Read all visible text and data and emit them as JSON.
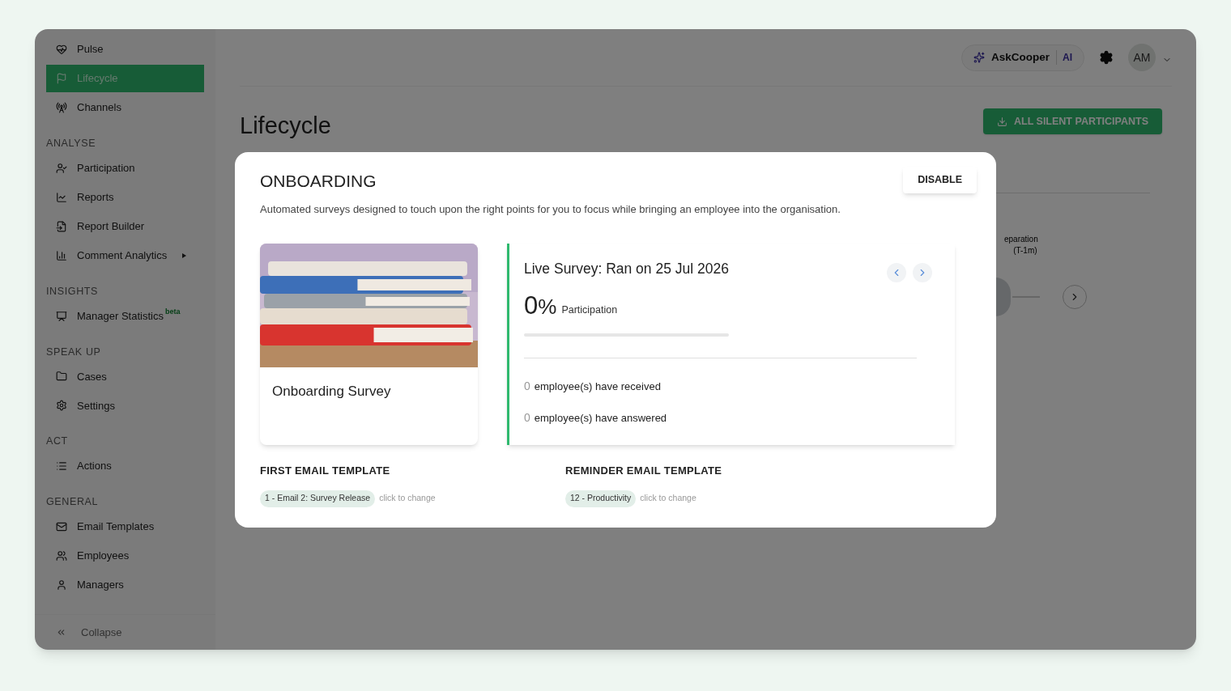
{
  "sidebar": {
    "sections": [
      {
        "items": [
          {
            "label": "Pulse",
            "selected": false
          },
          {
            "label": "Lifecycle",
            "selected": true
          },
          {
            "label": "Channels",
            "selected": false
          }
        ]
      },
      {
        "heading": "ANALYSE",
        "items": [
          {
            "label": "Participation",
            "selected": false
          },
          {
            "label": "Reports",
            "selected": false
          },
          {
            "label": "Report Builder",
            "selected": false
          },
          {
            "label": "Comment Analytics",
            "selected": false,
            "submenu": true
          }
        ]
      },
      {
        "heading": "INSIGHTS",
        "items": [
          {
            "label": "Manager Statistics",
            "selected": false,
            "badge": "beta"
          }
        ]
      },
      {
        "heading": "SPEAK UP",
        "items": [
          {
            "label": "Cases",
            "selected": false
          },
          {
            "label": "Settings",
            "selected": false
          }
        ]
      },
      {
        "heading": "ACT",
        "items": [
          {
            "label": "Actions",
            "selected": false
          }
        ]
      },
      {
        "heading": "GENERAL",
        "items": [
          {
            "label": "Email Templates",
            "selected": false
          },
          {
            "label": "Employees",
            "selected": false
          },
          {
            "label": "Managers",
            "selected": false
          }
        ]
      }
    ],
    "collapse": "Collapse"
  },
  "header": {
    "assistant": "AskCooper",
    "assistant_tag": "AI",
    "avatar": "AM"
  },
  "page": {
    "title": "Lifecycle",
    "export_button": "ALL SILENT PARTICIPANTS",
    "timeline_label": [
      "eparation",
      "(T-1m)"
    ]
  },
  "modal": {
    "title": "ONBOARDING",
    "disable_button": "DISABLE",
    "description": "Automated surveys designed to touch upon the right points for you to focus while bringing an employee into the organisation.",
    "survey_card": {
      "kind": "picture",
      "name": "Onboarding Survey"
    },
    "live": {
      "title": "Live Survey: Ran on 25 Jul 2026",
      "percent": "0",
      "percent_sign": "%",
      "percent_label": "Participation",
      "level": 0,
      "stats": [
        {
          "value": "0",
          "text": "employee(s) have received"
        },
        {
          "value": "0",
          "text": "employee(s) have answered"
        }
      ]
    },
    "templates": [
      {
        "heading": "FIRST EMAIL TEMPLATE",
        "chip": "1 - Email 2: Survey Release",
        "hint": "click to change"
      },
      {
        "heading": "REMINDER EMAIL TEMPLATE",
        "chip": "12 - Productivity",
        "hint": "click to change"
      }
    ]
  }
}
